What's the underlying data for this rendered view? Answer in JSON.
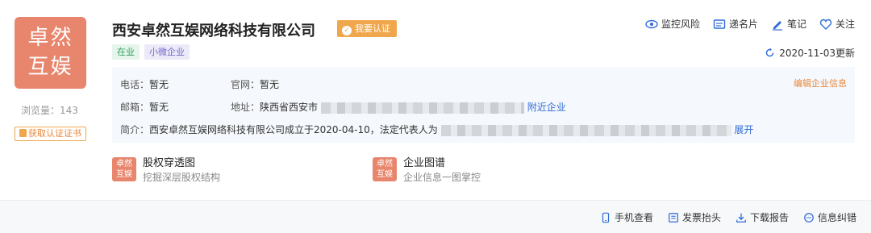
{
  "logo": {
    "line1": "卓然",
    "line2": "互娱"
  },
  "views": {
    "label": "浏览量：",
    "count": "143"
  },
  "cert_button": "获取认证证书",
  "company": {
    "name": "西安卓然互娱网络科技有限公司",
    "verify_label": "我要认证"
  },
  "tags": [
    "在业",
    "小微企业"
  ],
  "actions": [
    "监控风险",
    "递名片",
    "笔记",
    "关注"
  ],
  "updated": "2020-11-03更新",
  "info": {
    "phone_label": "电话：",
    "phone": "暂无",
    "website_label": "官网：",
    "website": "暂无",
    "email_label": "邮箱：",
    "email": "暂无",
    "address_label": "地址：",
    "address": "陕西省西安市",
    "nearby": "附近企业",
    "intro_label": "简介：",
    "intro": "西安卓然互娱网络科技有限公司成立于2020-04-10，法定代表人为",
    "expand": "展开",
    "edit": "编辑企业信息"
  },
  "features": [
    {
      "logo1": "卓然",
      "logo2": "互娱",
      "title": "股权穿透图",
      "sub": "挖掘深层股权结构"
    },
    {
      "logo1": "卓然",
      "logo2": "互娱",
      "title": "企业图谱",
      "sub": "企业信息一图掌控"
    }
  ],
  "bottom_actions": [
    "手机查看",
    "发票抬头",
    "下载报告",
    "信息纠错"
  ],
  "colors": {
    "brand_orange": "#f0a74b",
    "logo_bg": "#e8866d",
    "link_blue": "#2f6bd6"
  }
}
